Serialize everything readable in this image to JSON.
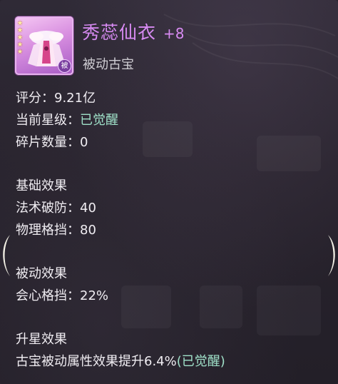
{
  "item": {
    "name": "秀蕊仙衣",
    "level": "+8",
    "type": "被动古宝",
    "badge": "被",
    "stars": [
      "★",
      "★",
      "★",
      "★",
      "★"
    ]
  },
  "stats": {
    "score_label": "评分：",
    "score_value": "9.21亿",
    "star_label": "当前星级：",
    "star_value": "已觉醒",
    "fragments_label": "碎片数量：",
    "fragments_value": "0"
  },
  "basic": {
    "header": "基础效果",
    "lines": [
      {
        "label": "法术破防：",
        "value": "40"
      },
      {
        "label": "物理格挡：",
        "value": "80"
      }
    ]
  },
  "passive": {
    "header": "被动效果",
    "lines": [
      {
        "label": "会心格挡：",
        "value": "22%"
      }
    ]
  },
  "upgrade": {
    "header": "升星效果",
    "text": "古宝被动属性效果提升6.4%",
    "status": "(已觉醒)"
  },
  "colors": {
    "name": "#d88bf3",
    "highlight": "#9fe0c8"
  },
  "icons": {
    "left": "chevron-left-icon",
    "right": "chevron-right-icon"
  }
}
